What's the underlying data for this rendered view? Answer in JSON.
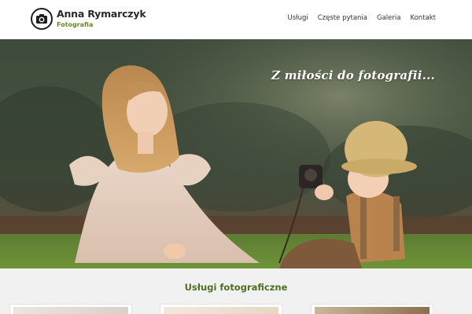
{
  "brand": {
    "name": "Anna Rymarczyk",
    "subtitle": "Fotografia"
  },
  "nav": {
    "items": [
      {
        "label": "Usługi"
      },
      {
        "label": "Częste pytania"
      },
      {
        "label": "Galeria"
      },
      {
        "label": "Kontakt"
      }
    ]
  },
  "hero": {
    "tagline": "Z miłości do fotografii..."
  },
  "services": {
    "title": "Usługi fotograficzne"
  },
  "colors": {
    "accent": "#6a8a2a",
    "title_green": "#4e6e25",
    "header_bg": "#ffffff",
    "section_bg": "#f1f1f1"
  }
}
